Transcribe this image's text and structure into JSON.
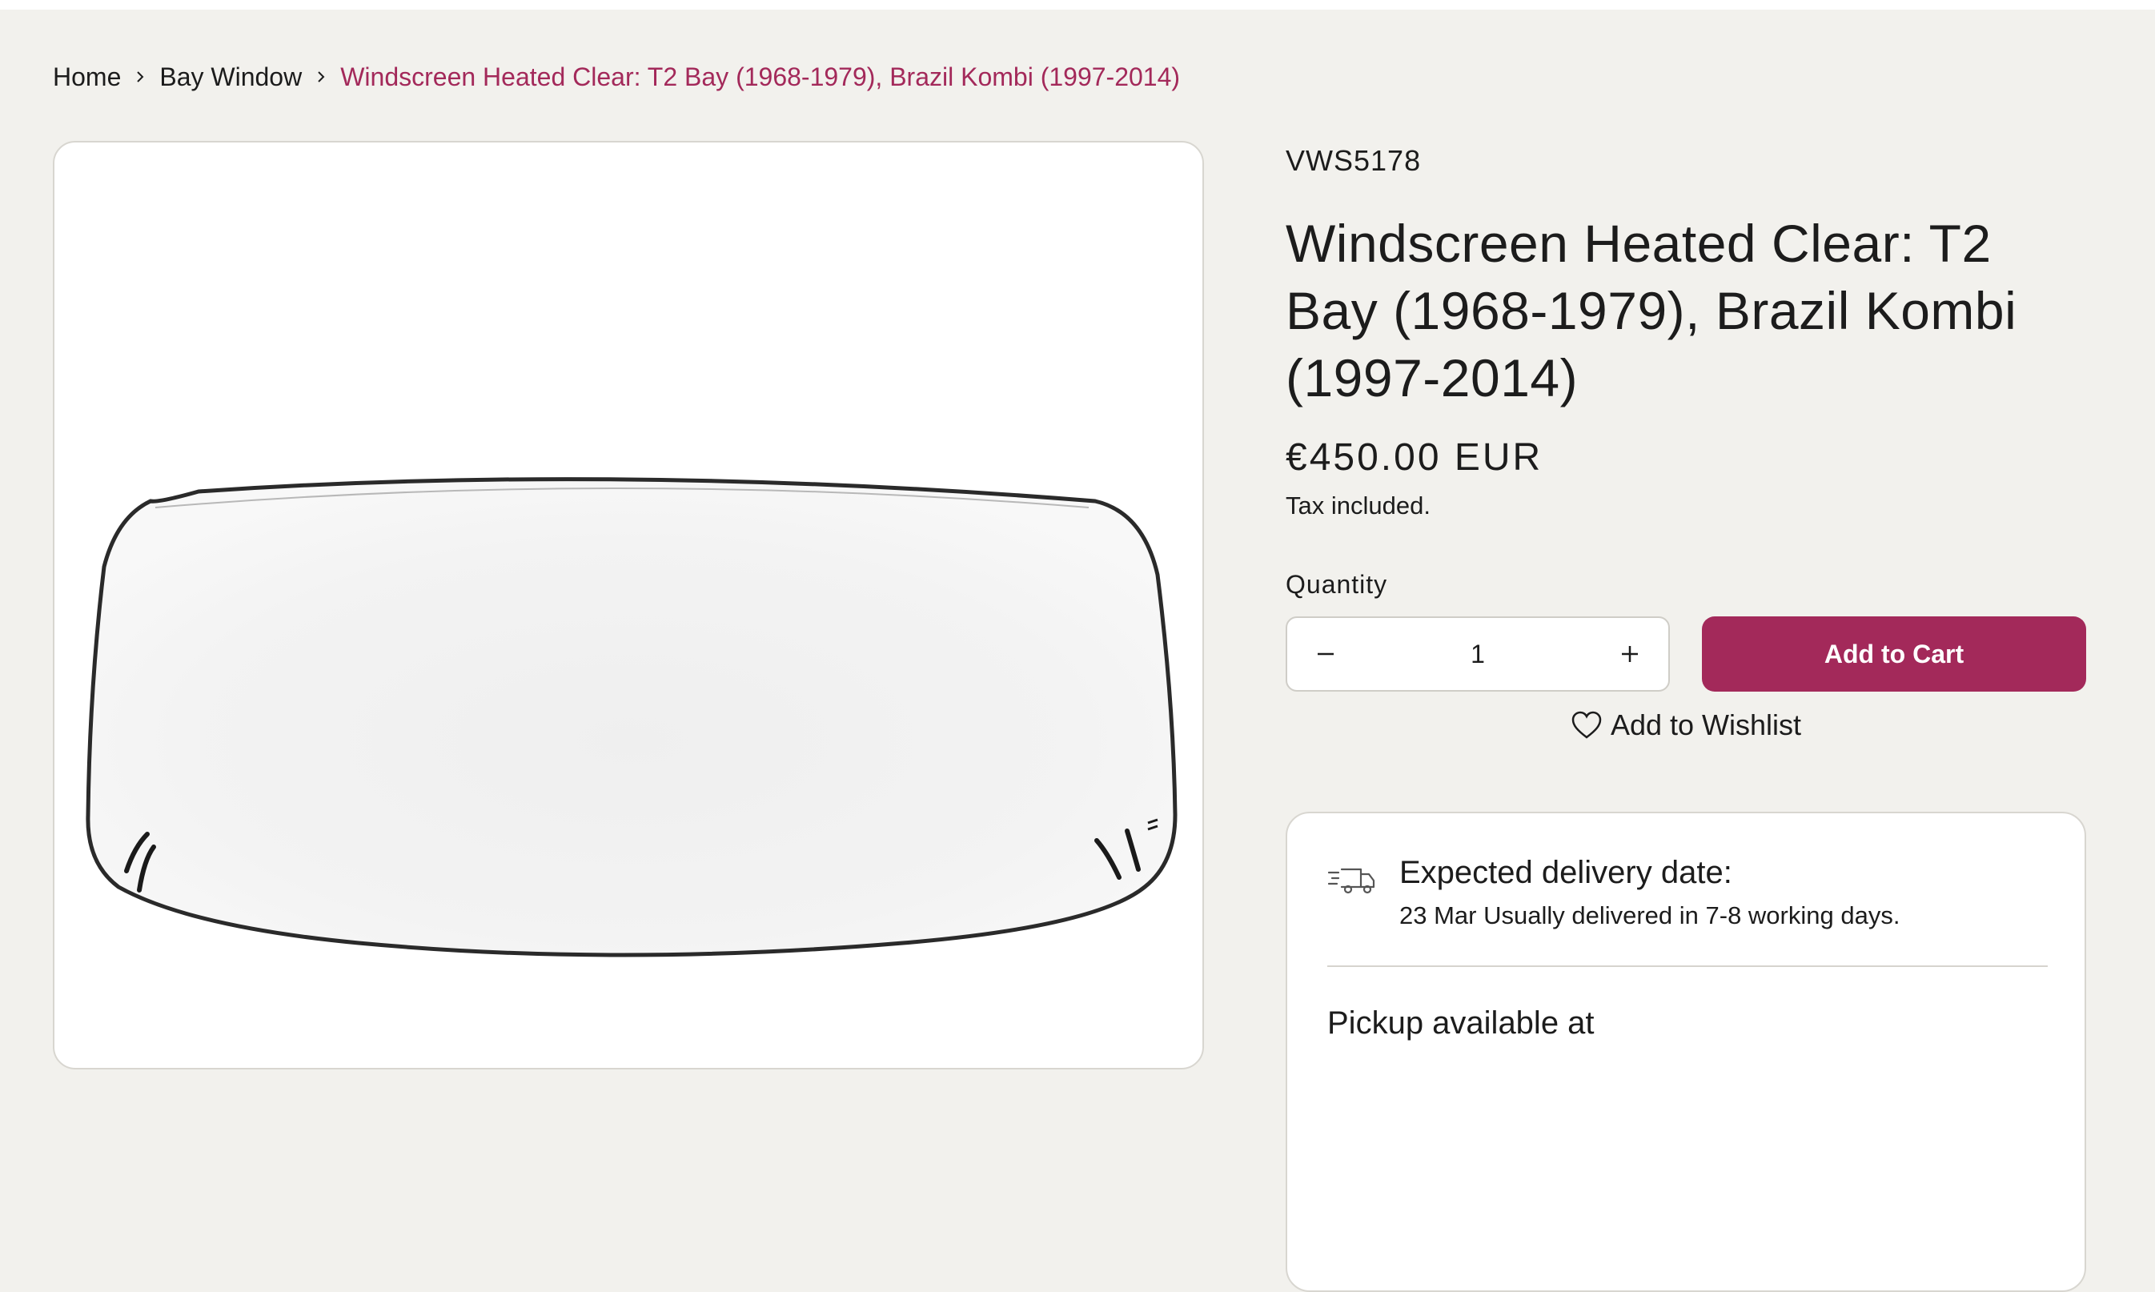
{
  "breadcrumb": {
    "items": [
      {
        "label": "Home"
      },
      {
        "label": "Bay Window"
      }
    ],
    "current": "Windscreen Heated Clear: T2 Bay (1968-1979), Brazil Kombi (1997-2014)"
  },
  "product": {
    "sku": "VWS5178",
    "title": "Windscreen Heated Clear: T2 Bay (1968-1979), Brazil Kombi (1997-2014)",
    "price": "€450.00 EUR",
    "tax_note": "Tax included.",
    "quantity_label": "Quantity",
    "quantity_value": "1",
    "add_to_cart_label": "Add to Cart",
    "wishlist_label": "Add to Wishlist",
    "image_subject": "heated windscreen glass"
  },
  "delivery": {
    "title": "Expected delivery date:",
    "text": "23 Mar Usually delivered in 7-8 working days.",
    "pickup_title": "Pickup available at"
  },
  "icons": {
    "breadcrumb_separator": "chevron-right-icon",
    "decrease": "minus-icon",
    "increase": "plus-icon",
    "wishlist": "heart-icon",
    "delivery": "truck-icon"
  },
  "colors": {
    "accent": "#a3295a",
    "background": "#f2f1ed",
    "text": "#1c1c1c"
  }
}
